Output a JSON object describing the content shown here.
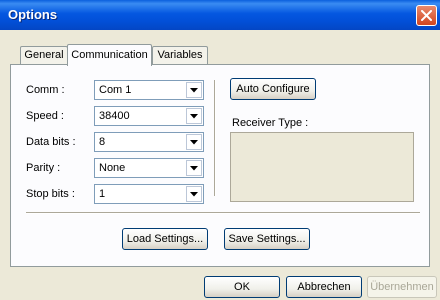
{
  "window": {
    "title": "Options"
  },
  "tabs": [
    {
      "label": "General",
      "active": false
    },
    {
      "label": "Communication",
      "active": true
    },
    {
      "label": "Variables",
      "active": false
    }
  ],
  "form": {
    "comm": {
      "label": "Comm :",
      "value": "Com 1"
    },
    "speed": {
      "label": "Speed :",
      "value": "38400"
    },
    "data_bits": {
      "label": "Data bits :",
      "value": "8"
    },
    "parity": {
      "label": "Parity :",
      "value": "None"
    },
    "stop_bits": {
      "label": "Stop bits :",
      "value": "1"
    }
  },
  "auto_configure": {
    "label": "Auto Configure"
  },
  "receiver": {
    "label": "Receiver Type :",
    "value": ""
  },
  "actions": {
    "load": "Load Settings...",
    "save": "Save Settings..."
  },
  "dialog_buttons": {
    "ok": "OK",
    "cancel": "Abbrechen",
    "apply": "Übernehmen",
    "apply_enabled": false
  },
  "colors": {
    "titlebar": "#0454e0",
    "face": "#ece9d8",
    "panel": "#fcfcfe",
    "close": "#d2451f"
  },
  "icons": {
    "close": "close-x-icon",
    "dropdown": "dropdown-arrow-icon"
  }
}
